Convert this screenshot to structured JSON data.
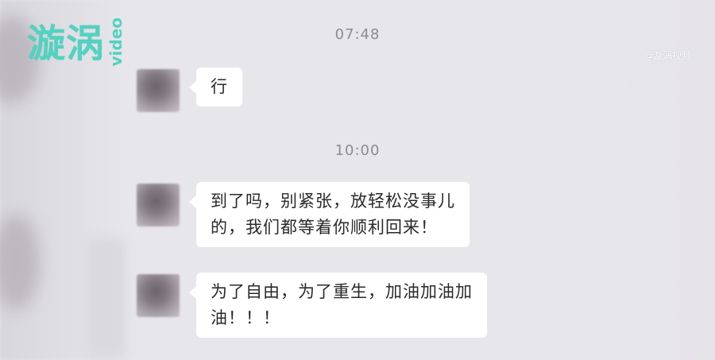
{
  "logo": {
    "main": "漩涡",
    "sub": "video"
  },
  "watermark": "@漩涡视频",
  "chat": {
    "messages": [
      {
        "time": "07:48",
        "text": "行"
      },
      {
        "time": "10:00",
        "text": "到了吗，别紧张，放轻松没事儿的，我们都等着你顺利回来！"
      },
      {
        "text": "为了自由，为了重生，加油加油加油！！！"
      }
    ],
    "bubble_lines": [
      [
        "行"
      ],
      [
        "到了吗，别紧张，放轻松没事儿",
        "的，我们都等着你顺利回来！"
      ],
      [
        "为了自由，为了重生，加油加油加",
        "油！！！"
      ]
    ]
  }
}
